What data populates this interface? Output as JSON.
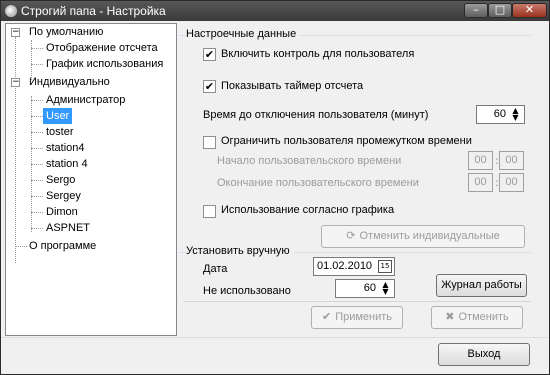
{
  "window": {
    "title": "Строгий папа - Настройка"
  },
  "titlebar_buttons": {
    "minimize": "–",
    "maximize": "□",
    "close": "✕"
  },
  "tree": {
    "nodes": [
      {
        "label": "По умолчанию",
        "expander": "−"
      },
      {
        "label": "Отображение отсчета"
      },
      {
        "label": "График использования"
      },
      {
        "label": "Индивидуально",
        "expander": "−"
      },
      {
        "label": "Администратор"
      },
      {
        "label": "User",
        "selected": true
      },
      {
        "label": "toster"
      },
      {
        "label": "station4"
      },
      {
        "label": "station 4"
      },
      {
        "label": "Sergo"
      },
      {
        "label": "Sergey"
      },
      {
        "label": "Dimon"
      },
      {
        "label": "ASPNET"
      },
      {
        "label": "О программе"
      }
    ]
  },
  "settings": {
    "group_title": "Настроечные данные",
    "enable_control": {
      "label": "Включить контроль для пользователя",
      "checked": true,
      "mark": "✔"
    },
    "show_timer": {
      "label": "Показывать таймер отсчета",
      "checked": true,
      "mark": "✔"
    },
    "disconnect_time": {
      "label": "Время до отключения пользователя (минут)",
      "value": "60"
    },
    "limit_interval": {
      "label": "Ограничить пользователя промежутком времени",
      "checked": false
    },
    "start_time": {
      "label": "Начало пользовательского времени",
      "hours": "00",
      "minutes": "00"
    },
    "end_time": {
      "label": "Окончание пользовательского времени",
      "hours": "00",
      "minutes": "00"
    },
    "use_schedule": {
      "label": "Использование согласно графика",
      "checked": false
    },
    "cancel_individual": {
      "label": "Отменить индивидуальные"
    }
  },
  "manual": {
    "group_title": "Установить вручную",
    "date": {
      "label": "Дата",
      "value": "01.02.2010"
    },
    "unused": {
      "label": "Не использовано",
      "value": "60"
    },
    "log_button": "Журнал работы"
  },
  "actions": {
    "apply": "Применить",
    "cancel": "Отменить"
  },
  "exit_button": "Выход",
  "colors": {
    "selection": "#3399ff",
    "disabled_text": "#9c9c9c",
    "titlebar": "#4a4a4a"
  }
}
